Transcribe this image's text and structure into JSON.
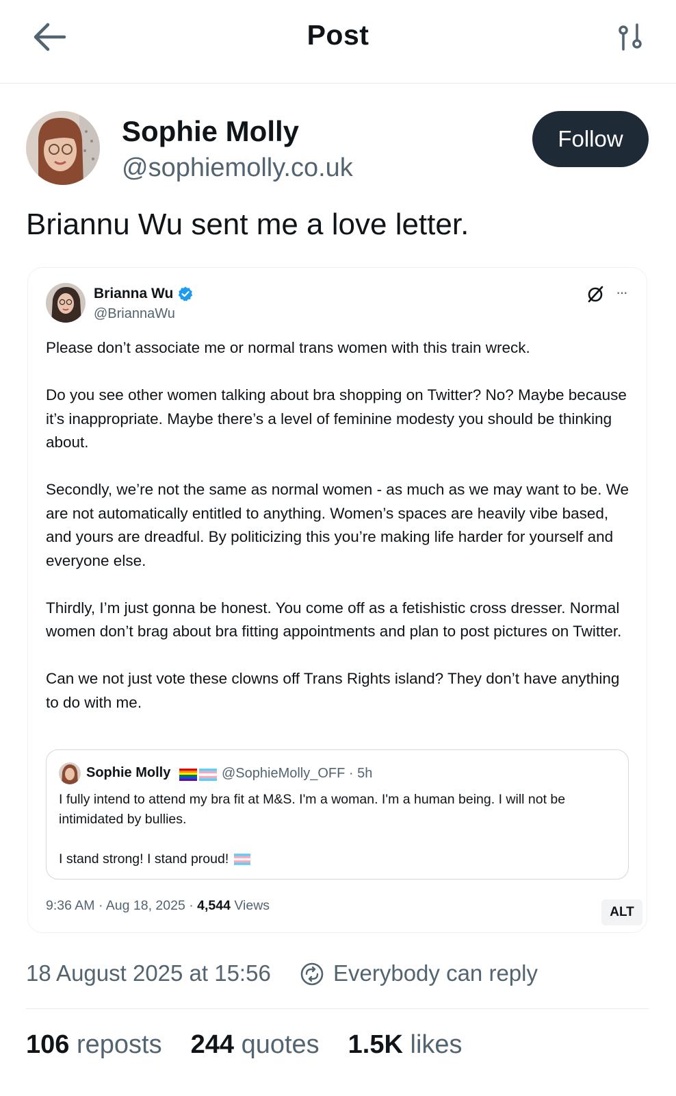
{
  "header": {
    "title": "Post",
    "back_icon": "arrow-left-icon",
    "filter_icon": "sliders-icon"
  },
  "author": {
    "name": "Sophie Molly",
    "handle": "@sophiemolly.co.uk",
    "follow_label": "Follow"
  },
  "post": {
    "text": "Briannu Wu sent me a love letter."
  },
  "embedded_tweet": {
    "name": "Brianna Wu",
    "handle": "@BriannaWu",
    "paragraphs": [
      "Please don’t associate me or normal trans women with this train wreck.",
      "Do you see other women talking about bra shopping on Twitter? No? Maybe because it’s inappropriate. Maybe there’s a level of feminine modesty you should be thinking about.",
      "Secondly, we’re not the same as normal women - as much as we may want to be. We are not automatically entitled to anything. Women’s spaces are heavily vibe based, and yours are dreadful. By politicizing this you’re making life harder for yourself and everyone else.",
      "Thirdly, I’m just gonna be honest. You come off as a fetishistic cross dresser. Normal women don’t brag about bra fitting appointments and plan to post pictures on Twitter.",
      "Can we not just vote these clowns off Trans Rights island? They don’t have anything to do with me."
    ],
    "quoted": {
      "name": "Sophie Molly",
      "handle_time": "@SophieMolly_OFF · 5h",
      "line1": "I fully intend to attend my bra fit at M&S. I'm a woman. I'm a human being. I will not be intimidated by bullies.",
      "line2": "I stand strong! I stand proud!"
    },
    "time": "9:36 AM · Aug 18, 2025 · ",
    "views_count": "4,544",
    "views_label": " Views",
    "alt_label": "ALT"
  },
  "footer": {
    "date": "18 August 2025 at 15:56",
    "reply_scope": "Everybody can reply",
    "reposts_count": "106",
    "reposts_label": "reposts",
    "quotes_count": "244",
    "quotes_label": "quotes",
    "likes_count": "1.5K",
    "likes_label": "likes"
  },
  "colors": {
    "primary_text": "#0f1419",
    "secondary_text": "#536471",
    "follow_bg": "#1f2a37",
    "verified_blue": "#1d9bf0"
  }
}
